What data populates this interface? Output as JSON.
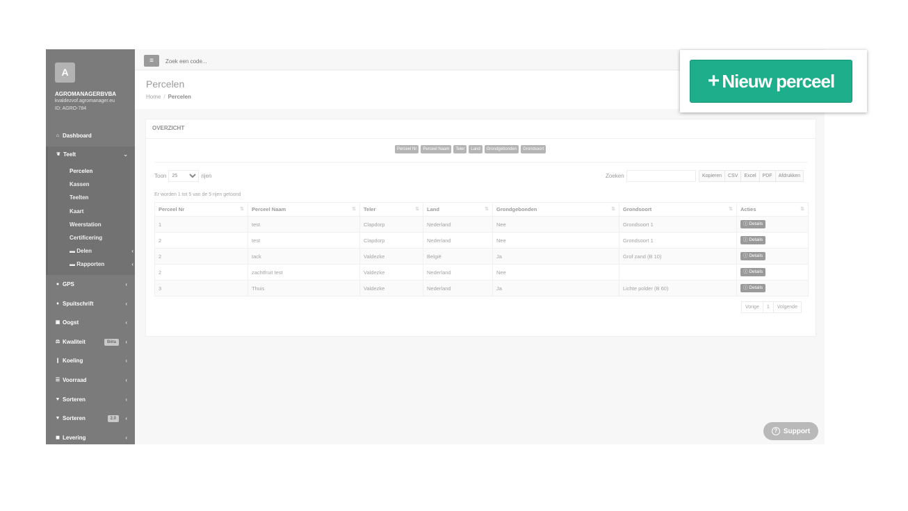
{
  "sidebar": {
    "avatar_letter": "A",
    "company": "AGROMANAGERBVBA",
    "email": "kvaldezvof.agromanager.eu",
    "ident": "ID: AGRO-784",
    "items": [
      {
        "label": "Dashboard",
        "icon": "home-icon"
      },
      {
        "label": "Teelt",
        "icon": "leaf-icon"
      },
      {
        "label": "GPS",
        "icon": "map-marker-icon"
      },
      {
        "label": "Spuitschrift",
        "icon": "drop-icon"
      },
      {
        "label": "Oogst",
        "icon": "basket-icon"
      },
      {
        "label": "Kwaliteit",
        "icon": "balance-icon",
        "badge": "Bèta"
      },
      {
        "label": "Koeling",
        "icon": "thermometer-icon"
      },
      {
        "label": "Voorraad",
        "icon": "list-icon"
      },
      {
        "label": "Sorteren",
        "icon": "filter-icon"
      },
      {
        "label": "Sorteren",
        "icon": "filter-icon",
        "badge": "2.0"
      },
      {
        "label": "Levering",
        "icon": "truck-icon"
      }
    ],
    "teelt_sub": [
      {
        "label": "Percelen"
      },
      {
        "label": "Kassen"
      },
      {
        "label": "Teelten"
      },
      {
        "label": "Kaart"
      },
      {
        "label": "Weerstation"
      },
      {
        "label": "Certificering"
      },
      {
        "label": "Delen"
      },
      {
        "label": "Rapporten"
      }
    ]
  },
  "topbar": {
    "search_placeholder": "Zoek een code..."
  },
  "header": {
    "title": "Percelen",
    "breadcrumb_home": "Home",
    "breadcrumb_current": "Percelen"
  },
  "panel": {
    "title": "OVERZICHT",
    "column_toggles": [
      "Perceel Nr",
      "Perceel Naam",
      "Teler",
      "Land",
      "Grondgebonden",
      "Grondsoort"
    ],
    "toon_label": "Toon",
    "toon_value": "25",
    "rijen_label": "rijen",
    "zoeken_label": "Zoeken",
    "export_buttons": [
      "Kopieren",
      "CSV",
      "Excel",
      "PDF",
      "Afdrukken"
    ],
    "info": "Er worden 1 tot 5 van de 5 rijen getoond",
    "columns": [
      "Perceel Nr",
      "Perceel Naam",
      "Teler",
      "Land",
      "Grondgebonden",
      "Grondsoort",
      "Acties"
    ],
    "rows": [
      [
        "1",
        "test",
        "Clapdorp",
        "Nederland",
        "Nee",
        "Grondsoort 1"
      ],
      [
        "2",
        "test",
        "Clapdorp",
        "Nederland",
        "Nee",
        "Grondsoort 1"
      ],
      [
        "2",
        "tack",
        "Valdezke",
        "België",
        "Ja",
        "Grof zand (B 10)"
      ],
      [
        "2",
        "zachtfruit test",
        "Valdezke",
        "Nederland",
        "Nee",
        ""
      ],
      [
        "3",
        "Thuis",
        "Valdezke",
        "Nederland",
        "Ja",
        "Lichte polder (B 60)"
      ]
    ],
    "details_label": "Details",
    "pagination": {
      "prev": "Vorige",
      "page": "1",
      "next": "Volgende"
    }
  },
  "callout": {
    "button_label": "Nieuw perceel",
    "button_color": "#1fae8c"
  },
  "support_label": "Support"
}
